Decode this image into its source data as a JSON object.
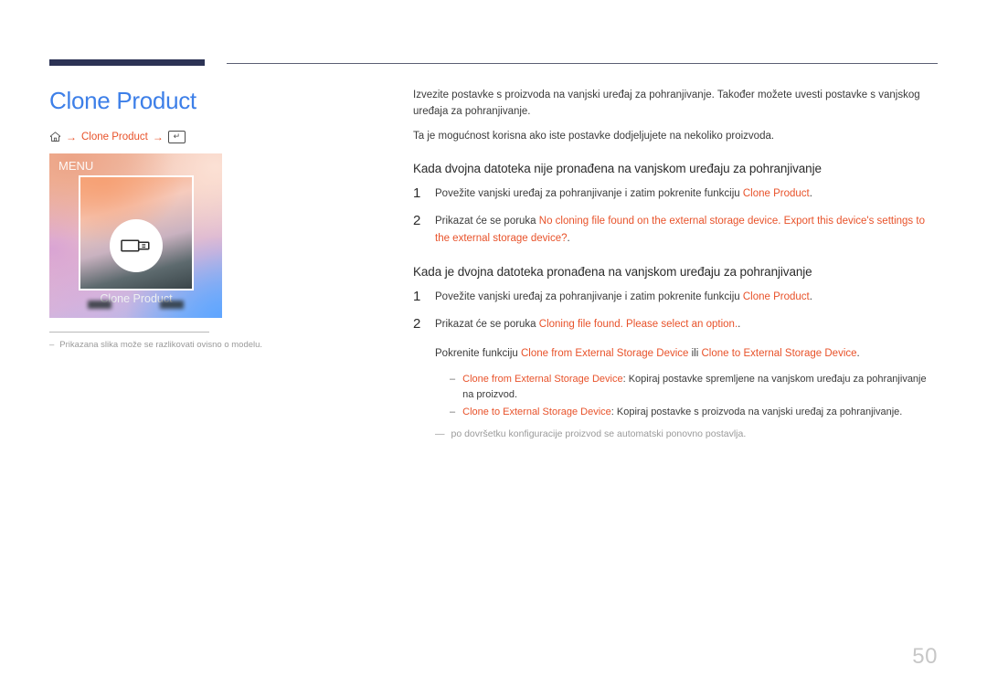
{
  "colors": {
    "accent_rule": "#2c3355",
    "title_blue": "#3d7fe8",
    "highlight_orange": "#e8522a",
    "body_text": "#3b3b3b",
    "muted": "#9a9a9a"
  },
  "header": {
    "title": "Clone Product"
  },
  "breadcrumb": {
    "home_icon": "home-icon",
    "arrow_1": "→",
    "item": "Clone Product",
    "arrow_2": "→",
    "enter_icon": "enter-key-icon",
    "enter_glyph": "↵"
  },
  "thumbnail": {
    "menu_label": "MENU",
    "panel_icon": "usb-drive-icon",
    "panel_label": "Clone Product"
  },
  "left_note": {
    "dash": "–",
    "text": "Prikazana slika može se razlikovati ovisno o modelu."
  },
  "main": {
    "intro_1": "Izvezite postavke s proizvoda na vanjski uređaj za pohranjivanje. Također možete uvesti postavke s vanjskog uređaja za pohranjivanje.",
    "intro_2": "Ta je mogućnost korisna ako iste postavke dodjeljujete na nekoliko proizvoda.",
    "section_1": {
      "heading": "Kada dvojna datoteka nije pronađena na vanjskom uređaju za pohranjivanje",
      "steps": [
        {
          "num": "1",
          "prefix": "Povežite vanjski uređaj za pohranjivanje i zatim pokrenite funkciju ",
          "highlight": "Clone Product",
          "suffix": "."
        },
        {
          "num": "2",
          "prefix": "Prikazat će se poruka ",
          "highlight": "No cloning file found on the external storage device. Export this device's settings to the external storage device?",
          "suffix": "."
        }
      ]
    },
    "section_2": {
      "heading": "Kada je dvojna datoteka pronađena na vanjskom uređaju za pohranjivanje",
      "steps": [
        {
          "num": "1",
          "prefix": "Povežite vanjski uređaj za pohranjivanje i zatim pokrenite funkciju ",
          "highlight": "Clone Product",
          "suffix": "."
        },
        {
          "num": "2",
          "prefix": "Prikazat će se poruka ",
          "highlight": "Cloning file found. Please select an option.",
          "suffix": "."
        }
      ],
      "sub_para": {
        "prefix": "Pokrenite funkciju ",
        "highlight_1": "Clone from External Storage Device",
        "middle": " ili ",
        "highlight_2": "Clone to External Storage Device",
        "suffix": "."
      },
      "bullets": [
        {
          "dash": "–",
          "highlight": "Clone from External Storage Device",
          "text": ": Kopiraj postavke spremljene na vanjskom uređaju za pohranjivanje na proizvod."
        },
        {
          "dash": "–",
          "highlight": "Clone to External Storage Device",
          "text": ": Kopiraj postavke s proizvoda na vanjski uređaj za pohranjivanje."
        }
      ],
      "tail_note": {
        "dash": "—",
        "text": "po dovršetku konfiguracije proizvod se automatski ponovno postavlja."
      }
    }
  },
  "footer": {
    "page_number": "50"
  }
}
